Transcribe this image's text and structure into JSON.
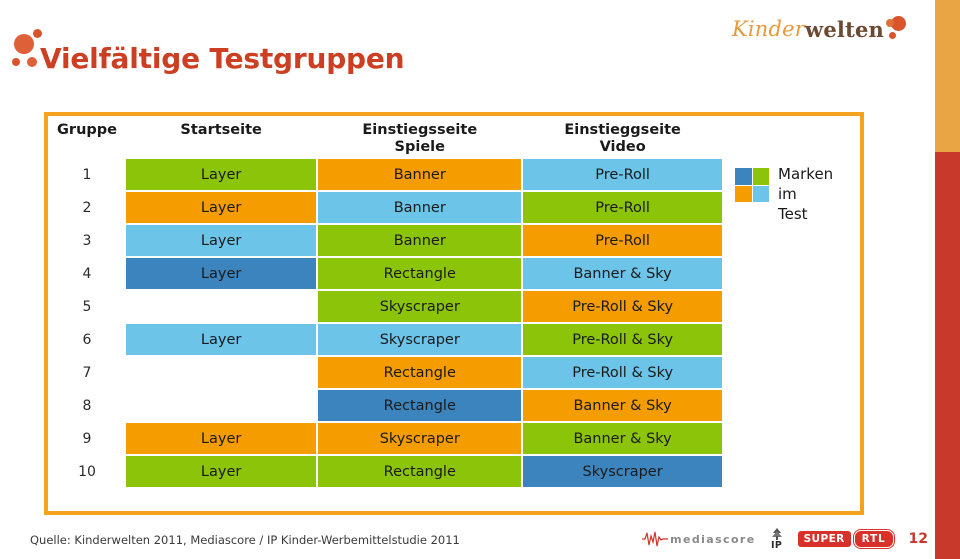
{
  "slide": {
    "title": "Vielfältige Testgruppen",
    "page_number": "12",
    "title_color": "#CC3F22",
    "frame_color": "#F5A21E"
  },
  "logo": {
    "part1": "Kinder",
    "part2": "welten"
  },
  "table": {
    "headers": [
      "Gruppe",
      "Startseite",
      "Einstiegsseite\nSpiele",
      "Einstieggseite\nVideo"
    ],
    "rows": [
      {
        "group": "1",
        "startseite": {
          "label": "Layer",
          "color": "green"
        },
        "spiele": {
          "label": "Banner",
          "color": "orange"
        },
        "video": {
          "label": "Pre-Roll",
          "color": "lblue"
        }
      },
      {
        "group": "2",
        "startseite": {
          "label": "Layer",
          "color": "orange"
        },
        "spiele": {
          "label": "Banner",
          "color": "lblue"
        },
        "video": {
          "label": "Pre-Roll",
          "color": "green"
        }
      },
      {
        "group": "3",
        "startseite": {
          "label": "Layer",
          "color": "lblue"
        },
        "spiele": {
          "label": "Banner",
          "color": "green"
        },
        "video": {
          "label": "Pre-Roll",
          "color": "orange"
        }
      },
      {
        "group": "4",
        "startseite": {
          "label": "Layer",
          "color": "dblue"
        },
        "spiele": {
          "label": "Rectangle",
          "color": "green"
        },
        "video": {
          "label": "Banner & Sky",
          "color": "lblue"
        }
      },
      {
        "group": "5",
        "startseite": {
          "label": "",
          "color": "empty"
        },
        "spiele": {
          "label": "Skyscraper",
          "color": "green"
        },
        "video": {
          "label": "Pre-Roll & Sky",
          "color": "orange"
        }
      },
      {
        "group": "6",
        "startseite": {
          "label": "Layer",
          "color": "lblue"
        },
        "spiele": {
          "label": "Skyscraper",
          "color": "lblue"
        },
        "video": {
          "label": "Pre-Roll & Sky",
          "color": "green"
        }
      },
      {
        "group": "7",
        "startseite": {
          "label": "",
          "color": "empty"
        },
        "spiele": {
          "label": "Rectangle",
          "color": "orange"
        },
        "video": {
          "label": "Pre-Roll & Sky",
          "color": "lblue"
        }
      },
      {
        "group": "8",
        "startseite": {
          "label": "",
          "color": "empty"
        },
        "spiele": {
          "label": "Rectangle",
          "color": "dblue"
        },
        "video": {
          "label": "Banner & Sky",
          "color": "orange"
        }
      },
      {
        "group": "9",
        "startseite": {
          "label": "Layer",
          "color": "orange"
        },
        "spiele": {
          "label": "Skyscraper",
          "color": "orange"
        },
        "video": {
          "label": "Banner & Sky",
          "color": "green"
        }
      },
      {
        "group": "10",
        "startseite": {
          "label": "Layer",
          "color": "green"
        },
        "spiele": {
          "label": "Rectangle",
          "color": "green"
        },
        "video": {
          "label": "Skyscraper",
          "color": "dblue"
        }
      }
    ]
  },
  "legend": {
    "label": "Marken\nim\nTest",
    "swatches": [
      "#3C84BE",
      "#8CC409",
      "#F59C00",
      "#6CC4E9"
    ]
  },
  "footer": {
    "source": "Quelle: Kinderwelten 2011, Mediascore / IP Kinder-Werbemittelstudie 2011",
    "mediascore_label": "mediascore",
    "ip_label": "IP",
    "rtl_super": "SUPER",
    "rtl_rtl": "RTL"
  },
  "palette": {
    "green": "#8CC409",
    "orange": "#F59C00",
    "lblue": "#6CC4E9",
    "dblue": "#3C84BE"
  }
}
